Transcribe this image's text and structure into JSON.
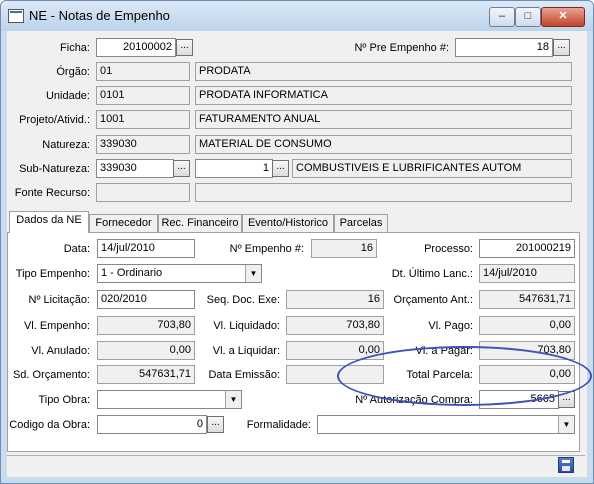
{
  "window": {
    "title": "NE - Notas de Empenho"
  },
  "header": {
    "ficha": {
      "label": "Ficha:",
      "value": "20100002"
    },
    "pre_empenho": {
      "label": "Nº Pre Empenho #:",
      "value": "18"
    },
    "orgao": {
      "label": "Órgão:",
      "code": "01",
      "name": "PRODATA"
    },
    "unidade": {
      "label": "Unidade:",
      "code": "0101",
      "name": "PRODATA INFORMATICA"
    },
    "projeto": {
      "label": "Projeto/Ativid.:",
      "code": "1001",
      "name": "FATURAMENTO ANUAL"
    },
    "natureza": {
      "label": "Natureza:",
      "code": "339030",
      "name": "MATERIAL DE CONSUMO"
    },
    "sub_natureza": {
      "label": "Sub-Natureza:",
      "code": "339030",
      "seq": "1",
      "name": "COMBUSTIVEIS E LUBRIFICANTES  AUTOM"
    },
    "fonte": {
      "label": "Fonte Recurso:",
      "code": "",
      "name": ""
    }
  },
  "tabs": [
    "Dados da NE",
    "Fornecedor",
    "Rec. Financeiro",
    "Evento/Historico",
    "Parcelas"
  ],
  "ellipsis": "...",
  "dados": {
    "data": {
      "label": "Data:",
      "value": "14/jul/2010"
    },
    "num_empenho": {
      "label": "Nº Empenho #:",
      "value": "16"
    },
    "processo": {
      "label": "Processo:",
      "value": "201000219"
    },
    "tipo_empenho": {
      "label": "Tipo Empenho:",
      "value": "1 - Ordinario"
    },
    "dt_ultimo": {
      "label": "Dt. Último Lanc.:",
      "value": "14/jul/2010"
    },
    "licitacao": {
      "label": "Nº Licitação:",
      "value": "020/2010"
    },
    "seq_doc": {
      "label": "Seq. Doc. Exe:",
      "value": "16"
    },
    "orcamento_ant": {
      "label": "Orçamento Ant.:",
      "value": "547631,71"
    },
    "vl_empenho": {
      "label": "Vl. Empenho:",
      "value": "703,80"
    },
    "vl_liquidado": {
      "label": "Vl. Liquidado:",
      "value": "703,80"
    },
    "vl_pago": {
      "label": "Vl. Pago:",
      "value": "0,00"
    },
    "vl_anulado": {
      "label": "Vl. Anulado:",
      "value": "0,00"
    },
    "vl_a_liquidar": {
      "label": "Vl. a Liquidar:",
      "value": "0,00"
    },
    "vl_a_pagar": {
      "label": "Vl. a Pagar:",
      "value": "703,80"
    },
    "sd_orcamento": {
      "label": "Sd. Orçamento:",
      "value": "547631,71"
    },
    "data_emissao": {
      "label": "Data Emissão:",
      "value": ""
    },
    "total_parcela": {
      "label": "Total Parcela:",
      "value": "0,00"
    },
    "tipo_obra": {
      "label": "Tipo Obra:",
      "value": ""
    },
    "autorizacao": {
      "label": "Nº Autorização Compra:",
      "value": "5665"
    },
    "codigo_obra": {
      "label": "Codigo da Obra:",
      "value": "0"
    },
    "formalidade": {
      "label": "Formalidade:",
      "value": ""
    }
  },
  "colors": {
    "annotation": "#3f51b5",
    "titlebar": "#bcd3ea"
  },
  "icons": {
    "window": "window-app-icon",
    "save": "save-disk-icon"
  }
}
